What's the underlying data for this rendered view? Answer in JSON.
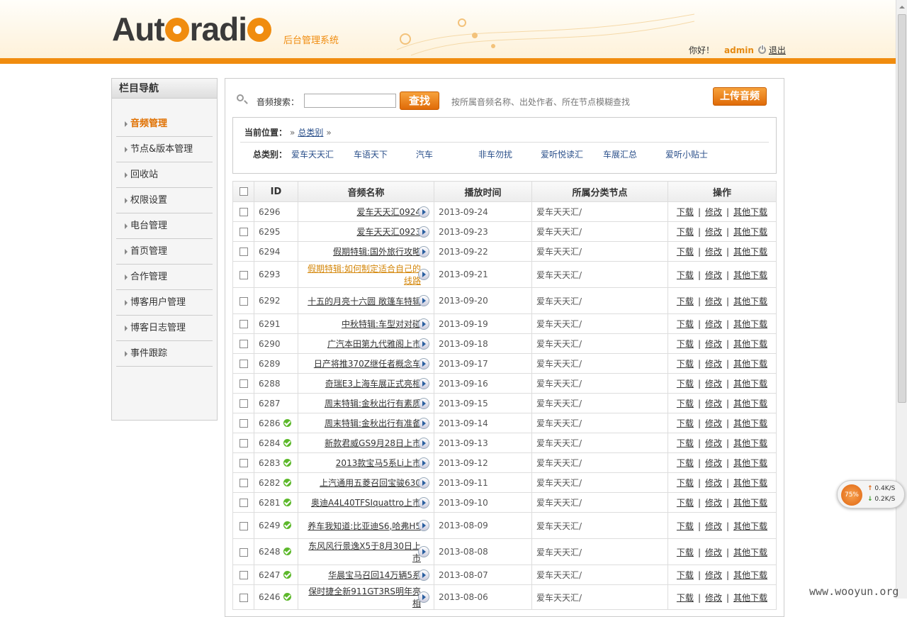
{
  "header": {
    "logo": "Autoradio",
    "subtitle": "后台管理系统",
    "greeting": "你好！",
    "username": "admin",
    "logout": "退出"
  },
  "sidebar": {
    "title": "栏目导航",
    "items": [
      {
        "label": "音频管理"
      },
      {
        "label": "节点&版本管理"
      },
      {
        "label": "回收站"
      },
      {
        "label": "权限设置"
      },
      {
        "label": "电台管理"
      },
      {
        "label": "首页管理"
      },
      {
        "label": "合作管理"
      },
      {
        "label": "博客用户管理"
      },
      {
        "label": "博客日志管理"
      },
      {
        "label": "事件跟踪"
      }
    ]
  },
  "search": {
    "label": "音频搜索：",
    "button": "查找",
    "hint": "按所属音频名称、出处作者、所在节点模糊查找",
    "upload": "上传音频"
  },
  "location": {
    "label": "当前位置：",
    "root": "总类别",
    "cat_label": "总类别：",
    "categories": [
      "爱车天天汇",
      "车语天下",
      "汽车",
      "非车勿扰",
      "爱听悦读汇",
      "车展汇总",
      "爱听小贴士"
    ]
  },
  "table": {
    "headers": [
      "ID",
      "音频名称",
      "播放时间",
      "所属分类节点",
      "操作"
    ],
    "ops": [
      "下载",
      "修改",
      "其他下载"
    ],
    "rows": [
      {
        "id": "6296",
        "name": "爱车天天汇0924",
        "date": "2013-09-24",
        "node": "爱车天天汇/"
      },
      {
        "id": "6295",
        "name": "爱车天天汇0923",
        "date": "2013-09-23",
        "node": "爱车天天汇/"
      },
      {
        "id": "6294",
        "name": "假期特辑:国外旅行攻略",
        "date": "2013-09-22",
        "node": "爱车天天汇/"
      },
      {
        "id": "6293",
        "name": "假期特辑:如何制定适合自己的线路",
        "date": "2013-09-21",
        "node": "爱车天天汇/"
      },
      {
        "id": "6292",
        "name": "十五的月亮十六圆 敞篷车特辑",
        "date": "2013-09-20",
        "node": "爱车天天汇/"
      },
      {
        "id": "6291",
        "name": "中秋特辑:车型对对碰",
        "date": "2013-09-19",
        "node": "爱车天天汇/"
      },
      {
        "id": "6290",
        "name": "广汽本田第九代雅阁上市",
        "date": "2013-09-18",
        "node": "爱车天天汇/"
      },
      {
        "id": "6289",
        "name": "日产将推370Z继任者概念车",
        "date": "2013-09-17",
        "node": "爱车天天汇/"
      },
      {
        "id": "6288",
        "name": "奇瑞E3上海车展正式亮相",
        "date": "2013-09-16",
        "node": "爱车天天汇/"
      },
      {
        "id": "6287",
        "name": "周末特辑:金秋出行有素质",
        "date": "2013-09-15",
        "node": "爱车天天汇/"
      },
      {
        "id": "6286",
        "name": "周末特辑:金秋出行有准备",
        "date": "2013-09-14",
        "node": "爱车天天汇/"
      },
      {
        "id": "6284",
        "name": "新款君威GS9月28日上市",
        "date": "2013-09-13",
        "node": "爱车天天汇/"
      },
      {
        "id": "6283",
        "name": "2013款宝马5系Li上市",
        "date": "2013-09-12",
        "node": "爱车天天汇/"
      },
      {
        "id": "6282",
        "name": "上汽通用五菱召回宝骏630",
        "date": "2013-09-11",
        "node": "爱车天天汇/"
      },
      {
        "id": "6281",
        "name": "奥迪A4L40TFSIquattro上市",
        "date": "2013-09-10",
        "node": "爱车天天汇/"
      },
      {
        "id": "6249",
        "name": "养车我知道:比亚迪S6,哈弗H5",
        "date": "2013-08-09",
        "node": "爱车天天汇/"
      },
      {
        "id": "6248",
        "name": "东风风行景逸X5于8月30日上市",
        "date": "2013-08-08",
        "node": "爱车天天汇/"
      },
      {
        "id": "6247",
        "name": "华晨宝马召回14万辆5系",
        "date": "2013-08-07",
        "node": "爱车天天汇/"
      },
      {
        "id": "6246",
        "name": "保时捷全新911GT3RS明年亮相",
        "date": "2013-08-06",
        "node": "爱车天天汇/"
      }
    ]
  },
  "speed": {
    "percent": "75%",
    "up": "0.4K/S",
    "down": "0.2K/S"
  },
  "watermark": "www.wooyun.org"
}
